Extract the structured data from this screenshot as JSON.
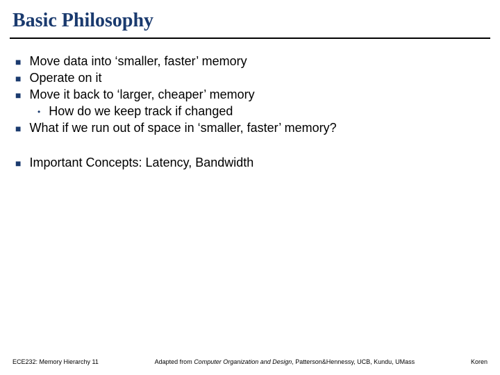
{
  "title": "Basic Philosophy",
  "bullets": [
    {
      "text": "Move data into ‘smaller, faster’ memory"
    },
    {
      "text": "Operate on it"
    },
    {
      "text": "Move it back to ‘larger, cheaper’ memory",
      "sub": [
        {
          "text": "How do we keep track if changed"
        }
      ]
    },
    {
      "text": "What if we run out of space in ‘smaller, faster’ memory?"
    }
  ],
  "bullets2": [
    {
      "text": "Important Concepts: Latency, Bandwidth"
    }
  ],
  "footer": {
    "left": "ECE232: Memory Hierarchy 11",
    "center_prefix": "Adapted from ",
    "center_italic": "Computer Organization and Design",
    "center_suffix": ", Patterson&Hennessy, UCB, Kundu, UMass",
    "right": "Koren"
  }
}
